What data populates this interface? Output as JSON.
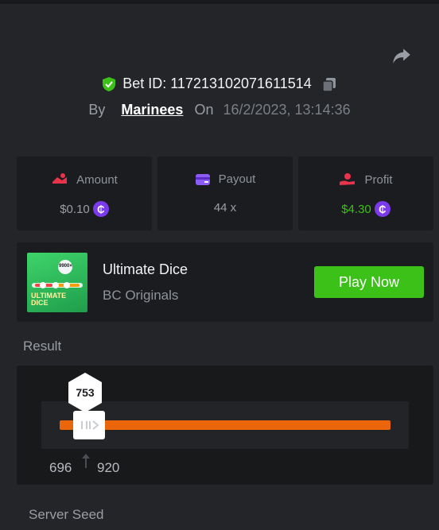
{
  "bet": {
    "id_label": "Bet ID: 117213102071611514",
    "by_label": "By",
    "user": "Marinees",
    "on_label": "On",
    "date": "16/2/2023, 13:14:36"
  },
  "stats": {
    "amount": {
      "label": "Amount",
      "value": "$0.10"
    },
    "payout": {
      "label": "Payout",
      "value": "44 x"
    },
    "profit": {
      "label": "Profit",
      "value": "$4.30"
    }
  },
  "currency_glyph": "₵",
  "game": {
    "title": "Ultimate Dice",
    "provider": "BC Originals",
    "thumb_text": "ULTIMATE DICE",
    "thumb_badge": "9900×",
    "play_label": "Play Now"
  },
  "result": {
    "label": "Result",
    "value": "753",
    "range_low": "696",
    "range_high": "920"
  },
  "server_seed_label": "Server Seed",
  "colors": {
    "background": "#232528",
    "card": "#1b1c1f",
    "accent_green": "#3bc117",
    "profit_green": "#3bc117",
    "track_orange": "#eb650a",
    "coin_purple": "#7c3aed",
    "verified_green": "#3bc117"
  },
  "icons": {
    "share": "share-arrow-icon",
    "verified": "shield-check-icon",
    "copy": "copy-icon",
    "amount": "money-hand-icon",
    "payout": "card-icon",
    "profit": "hand-coin-icon",
    "handle": "slider-grip-icon",
    "range": "up-arrow-icon"
  }
}
